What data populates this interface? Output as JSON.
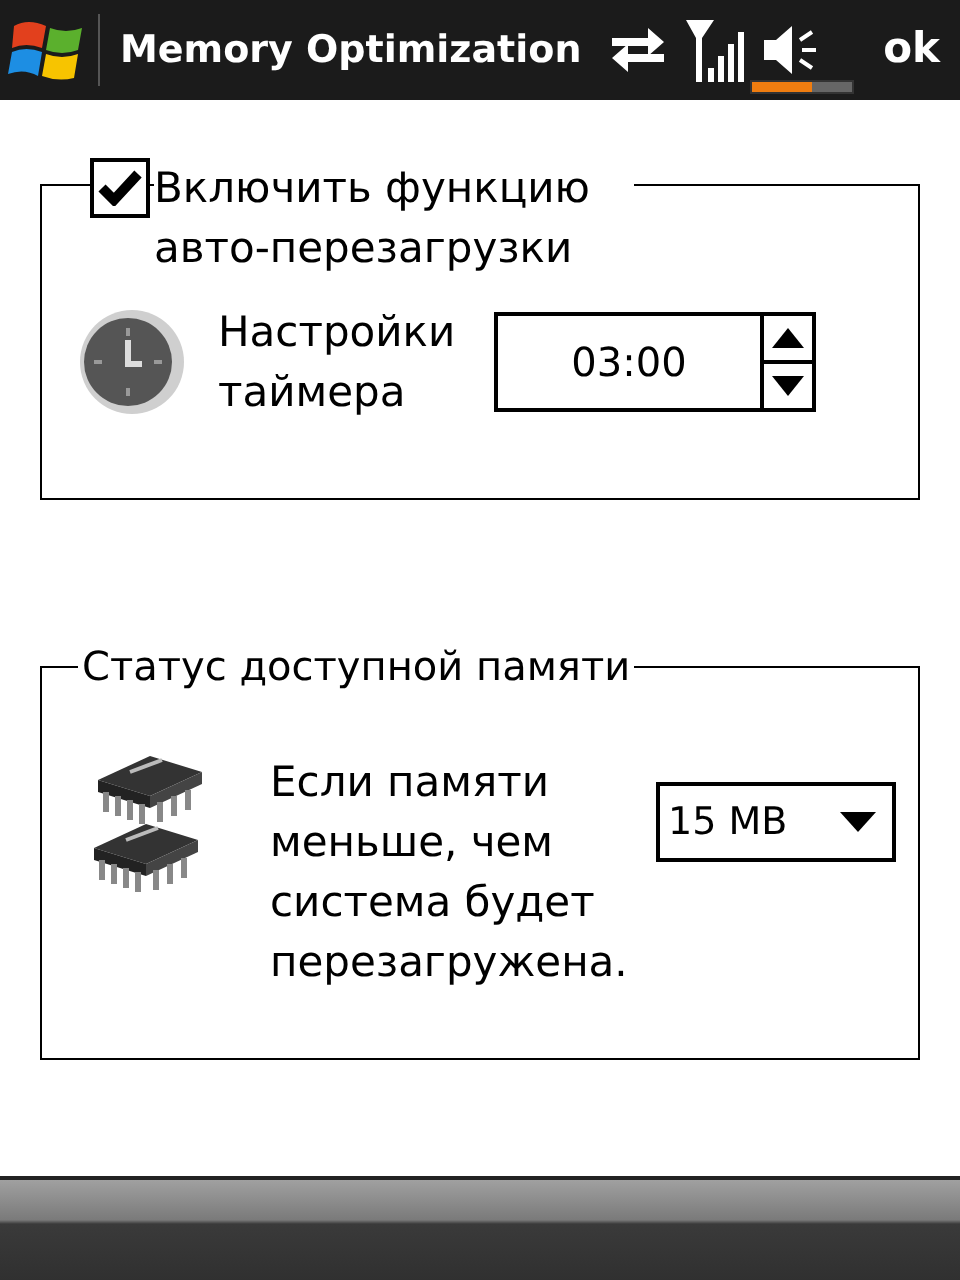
{
  "title_bar": {
    "title": "Memory Optimization",
    "volume": {
      "level": 0.6
    },
    "ok_button": "ok"
  },
  "auto_restart": {
    "checkbox": {
      "label": "Включить функцию авто-перезагрузки",
      "checked": true
    },
    "timer_label": "Настройки таймера",
    "timer_value": "03:00"
  },
  "memory_status": {
    "legend": "Статус доступной памяти",
    "description": "Если памяти меньше, чем система будет перезагружена.",
    "threshold": "15 MB"
  }
}
